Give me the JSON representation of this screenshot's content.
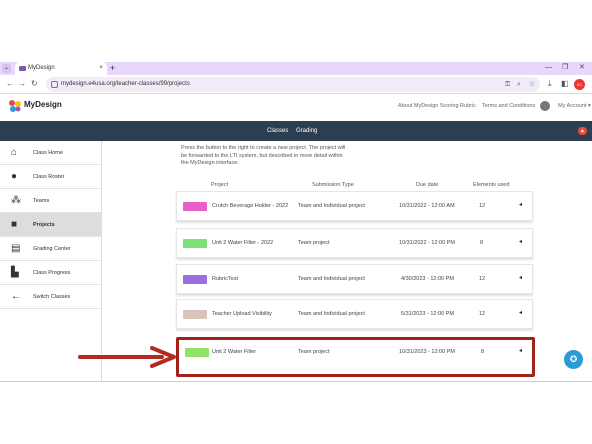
{
  "browser": {
    "tab_title": "MyDesign",
    "tab_close": "×",
    "new_tab": "+",
    "tab_dropdown": "⌄",
    "window_min": "—",
    "window_max": "❐",
    "window_close": "✕",
    "back": "←",
    "forward": "→",
    "reload": "↻",
    "url": "mydesign.e4usa.org/teacher-classes/99/projects",
    "profile_badge": "KC"
  },
  "header": {
    "logo_text": "MyDesign",
    "links": [
      "About MyDesign Scoring Rubric",
      "Terms and Conditions"
    ],
    "account": "My Account ▾"
  },
  "nav": {
    "items": [
      "Classes",
      "Grading"
    ],
    "alert": "▲"
  },
  "sidebar": {
    "items": [
      {
        "label": "Class Home",
        "icon": "home-icon",
        "glyph": "⌂"
      },
      {
        "label": "Class Roster",
        "icon": "person-icon",
        "glyph": "●"
      },
      {
        "label": "Teams",
        "icon": "group-icon",
        "glyph": "⁂"
      },
      {
        "label": "Projects",
        "icon": "cube-icon",
        "glyph": "■",
        "active": true
      },
      {
        "label": "Grading Center",
        "icon": "book-icon",
        "glyph": "▤"
      },
      {
        "label": "Class Progress",
        "icon": "chart-icon",
        "glyph": "▙"
      },
      {
        "label": "Switch Classes",
        "icon": "arrow-left-icon",
        "glyph": "←"
      }
    ]
  },
  "intro_text": "Press the button to the right to create a new project. The project will be forwarded to the LTI system, but described in more detail within the MyDesign interface.",
  "columns": [
    "Project",
    "Submission Type",
    "Due date",
    "Elements used"
  ],
  "projects": [
    {
      "name": "Crutch Beverage Holder - 2022",
      "type": "Team and Individual project",
      "due": "10/31/2022 - 12:00 AM",
      "elements": "12",
      "color": "#e85fc8"
    },
    {
      "name": "Unit 2 Water Filter - 2022",
      "type": "Team project",
      "due": "10/31/2022 - 12:00 PM",
      "elements": "8",
      "color": "#7ee07a"
    },
    {
      "name": "RubricTest",
      "type": "Team and Individual project",
      "due": "4/30/2023 - 12:00 PM",
      "elements": "12",
      "color": "#9a6fe0"
    },
    {
      "name": "Teacher Upload Visibility",
      "type": "Team and Individual project",
      "due": "5/31/2023 - 12:00 PM",
      "elements": "12",
      "color": "#d8c4b8"
    },
    {
      "name": "Unit 2 Water Filter",
      "type": "Team project",
      "due": "10/31/2023 - 12:00 PM",
      "elements": "8",
      "color": "#93e06a"
    }
  ],
  "row_caret": "◂",
  "help_icon": "✪",
  "annotation": {
    "arrow_color": "#b32a1e",
    "box_color": "#a3231a"
  }
}
